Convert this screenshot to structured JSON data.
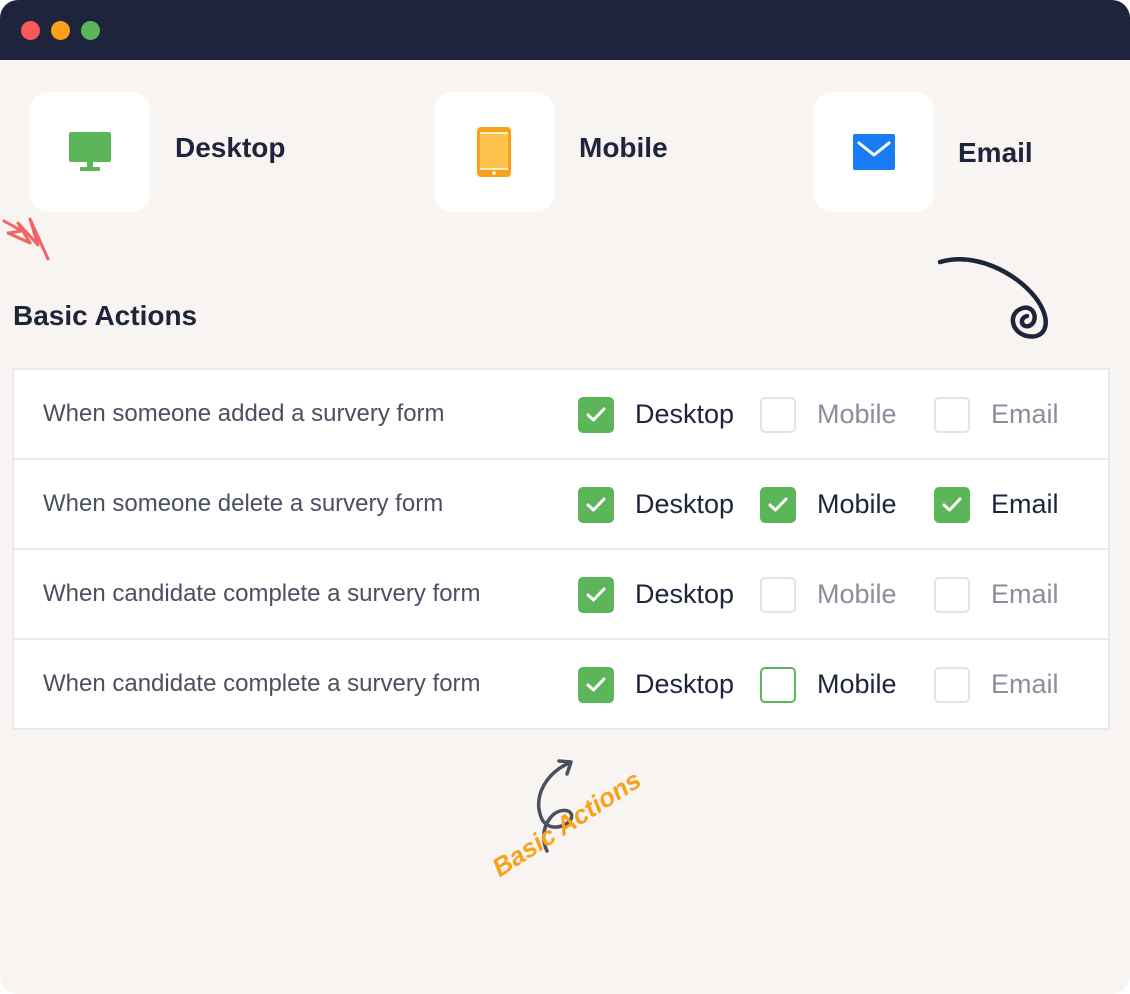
{
  "window": {
    "controls": [
      "close",
      "minimize",
      "maximize"
    ]
  },
  "channels": [
    {
      "label": "Desktop",
      "icon": "monitor-icon",
      "color": "#5db55a"
    },
    {
      "label": "Mobile",
      "icon": "phone-icon",
      "color": "#f9a11b"
    },
    {
      "label": "Email",
      "icon": "mail-icon",
      "color": "#1a7cf5"
    }
  ],
  "section": {
    "title": "Basic Actions"
  },
  "rows": [
    {
      "label": "When someone added a survery form",
      "options": [
        {
          "label": "Desktop",
          "state": "checked"
        },
        {
          "label": "Mobile",
          "state": "unchecked"
        },
        {
          "label": "Email",
          "state": "unchecked"
        }
      ]
    },
    {
      "label": "When someone delete a survery form",
      "options": [
        {
          "label": "Desktop",
          "state": "checked"
        },
        {
          "label": "Mobile",
          "state": "checked"
        },
        {
          "label": "Email",
          "state": "checked"
        }
      ]
    },
    {
      "label": "When candidate complete a survery form",
      "options": [
        {
          "label": "Desktop",
          "state": "checked"
        },
        {
          "label": "Mobile",
          "state": "unchecked"
        },
        {
          "label": "Email",
          "state": "unchecked"
        }
      ]
    },
    {
      "label": "When candidate complete a survery form",
      "options": [
        {
          "label": "Desktop",
          "state": "checked"
        },
        {
          "label": "Mobile",
          "state": "focused"
        },
        {
          "label": "Email",
          "state": "unchecked"
        }
      ]
    }
  ],
  "annotation": {
    "text": "Basic Actions"
  },
  "colors": {
    "accent_green": "#5db55a",
    "accent_orange": "#f9a11b",
    "accent_blue": "#1a7cf5",
    "dark": "#1e243b"
  }
}
